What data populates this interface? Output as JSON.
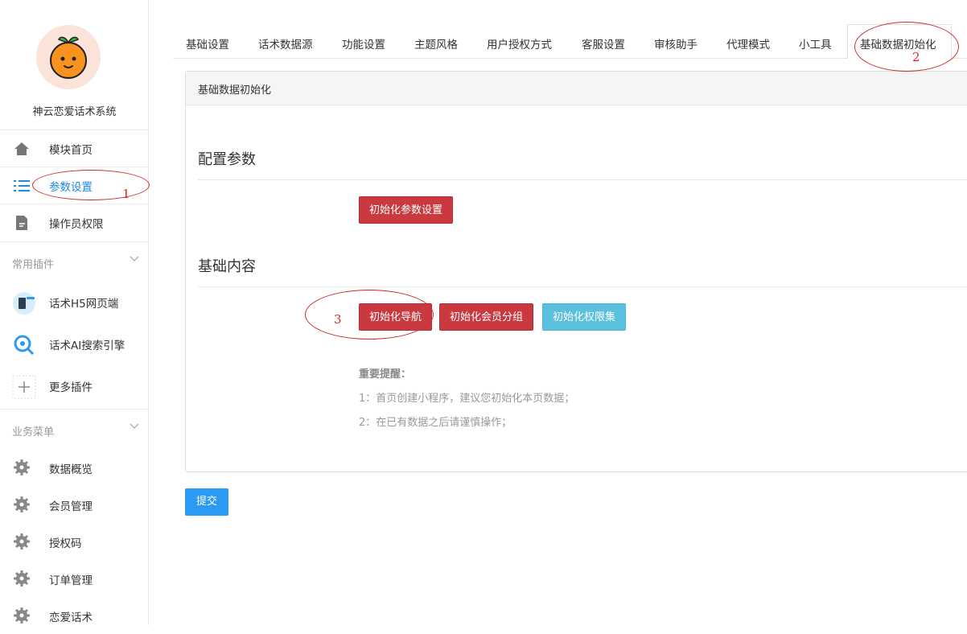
{
  "sidebar": {
    "app_name": "神云恋爱话术系统",
    "nav": [
      {
        "label": "模块首页",
        "icon": "home-icon"
      },
      {
        "label": "参数设置",
        "icon": "list-icon",
        "active": true
      },
      {
        "label": "操作员权限",
        "icon": "document-edit-icon"
      }
    ],
    "plugin_group": {
      "label": "常用插件"
    },
    "plugins": [
      {
        "label": "话术H5网页端",
        "icon": "h5-plugin-icon"
      },
      {
        "label": "话术AI搜索引擎",
        "icon": "ai-search-icon"
      },
      {
        "label": "更多插件",
        "icon": "plus-icon"
      }
    ],
    "business_group": {
      "label": "业务菜单"
    },
    "business": [
      {
        "label": "数据概览"
      },
      {
        "label": "会员管理"
      },
      {
        "label": "授权码"
      },
      {
        "label": "订单管理"
      },
      {
        "label": "恋爱话术"
      }
    ]
  },
  "tabs": [
    {
      "label": "基础设置"
    },
    {
      "label": "话术数据源"
    },
    {
      "label": "功能设置"
    },
    {
      "label": "主题风格"
    },
    {
      "label": "用户授权方式"
    },
    {
      "label": "客服设置"
    },
    {
      "label": "审核助手"
    },
    {
      "label": "代理模式"
    },
    {
      "label": "小工具"
    },
    {
      "label": "基础数据初始化",
      "active": true
    }
  ],
  "panel": {
    "header": "基础数据初始化",
    "config_section": {
      "title": "配置参数",
      "button": "初始化参数设置"
    },
    "content_section": {
      "title": "基础内容",
      "buttons": [
        "初始化导航",
        "初始化会员分组",
        "初始化权限集"
      ]
    },
    "notice": {
      "title": "重要提醒：",
      "lines": [
        "1：首页创建小程序，建议您初始化本页数据；",
        "2：在已有数据之后请谨慎操作；"
      ]
    }
  },
  "submit_label": "提交",
  "annotations": [
    "1",
    "2",
    "3"
  ],
  "colors": {
    "accent": "#1e88e5",
    "danger": "#c9393f",
    "info": "#5bc0de",
    "primary": "#2b9af3",
    "annotation": "#d42a2a"
  }
}
